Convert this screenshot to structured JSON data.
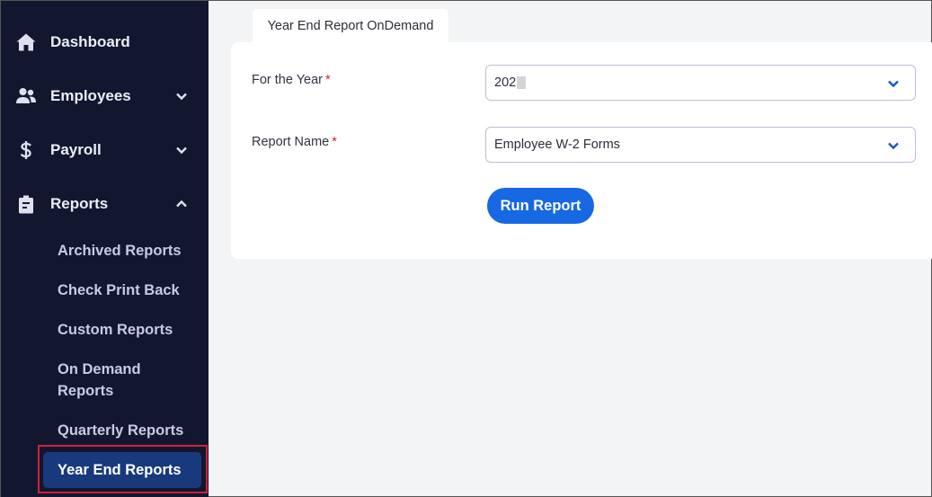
{
  "sidebar": {
    "items": [
      {
        "label": "Dashboard",
        "icon": "home-icon"
      },
      {
        "label": "Employees",
        "icon": "users-icon",
        "chevron": "down"
      },
      {
        "label": "Payroll",
        "icon": "dollar-icon",
        "chevron": "down"
      },
      {
        "label": "Reports",
        "icon": "clipboard-icon",
        "chevron": "up"
      }
    ],
    "reports_submenu": [
      "Archived Reports",
      "Check Print Back",
      "Custom Reports",
      "On Demand Reports",
      "Quarterly Reports",
      "Year End Reports"
    ],
    "active_submenu": "Year End Reports"
  },
  "tab": {
    "label": "Year End Report OnDemand"
  },
  "form": {
    "year": {
      "label": "For the Year",
      "required_mark": "*",
      "value": "202"
    },
    "report_name": {
      "label": "Report Name",
      "required_mark": "*",
      "value": "Employee W-2 Forms"
    },
    "run_button": "Run Report"
  },
  "colors": {
    "sidebar_bg": "#12172f",
    "active_bg": "#183a7c",
    "accent": "#1668e3",
    "required": "#d0213a",
    "highlight_border": "#d0213a"
  }
}
